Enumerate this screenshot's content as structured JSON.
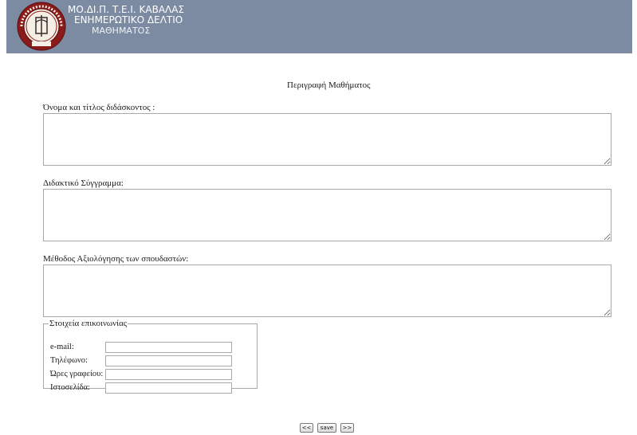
{
  "header": {
    "line1": "ΜΟ.ΔΙ.Π. Τ.Ε.Ι. ΚΑΒΑΛΑΣ",
    "line2": "ΕΝΗΜΕΡΩΤΙΚΟ ΔΕΛΤΙΟ",
    "line3": "ΜΑΘΗΜΑΤΟΣ",
    "seal_text": "ΤΕΧΝΟΛΟΓΙΚΟ ΕΚΠΑΙΔΕΥΤΙΚΟ ΙΔΡΥΜΑ ΚΑΒΑΛΑΣ"
  },
  "main": {
    "title": "Περιγραφή Μαθήματος",
    "fields": [
      {
        "label": "Όνομα και τίτλος διδάσκοντος :",
        "value": ""
      },
      {
        "label": "Διδακτικό Σύγγραμμα:",
        "value": ""
      },
      {
        "label": "Μέθοδος Αξιολόγησης των σπουδαστών:",
        "value": ""
      }
    ]
  },
  "contact": {
    "legend": "Στοιχεία επικοινωνίας",
    "rows": [
      {
        "label": "e-mail:",
        "value": ""
      },
      {
        "label": "Τηλέφωνο:",
        "value": ""
      },
      {
        "label": "Ώρες γραφείου:",
        "value": ""
      },
      {
        "label": "Ιστοσελίδα:",
        "value": ""
      }
    ]
  },
  "buttons": {
    "prev": "<<",
    "save": "save",
    "next": ">>"
  },
  "colors": {
    "header_bg": "#7c8aa2",
    "seal_red": "#8b1a1a"
  }
}
